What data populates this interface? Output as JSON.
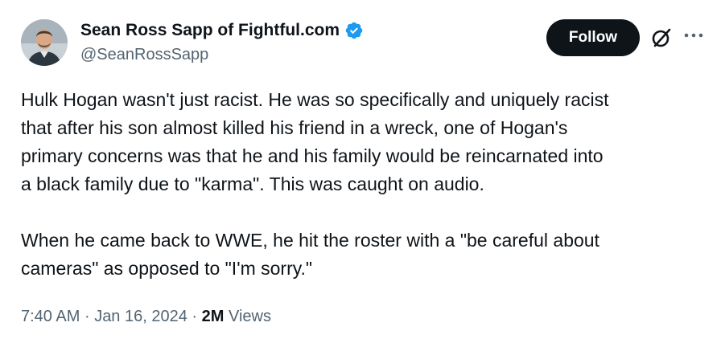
{
  "author": {
    "display_name": "Sean Ross Sapp of Fightful.com",
    "handle": "@SeanRossSapp",
    "verified": true
  },
  "actions": {
    "follow_label": "Follow",
    "grok_icon": "grok-icon",
    "more_icon": "more-options-icon"
  },
  "tweet": {
    "paragraph1_lines": [
      "Hulk Hogan wasn't just racist. He was so specifically and uniquely racist",
      "that after his son almost killed his friend in a wreck, one of Hogan's",
      "primary concerns was that he and his family would be reincarnated into",
      "a black family due to \"karma\". This was caught on audio."
    ],
    "paragraph2_lines": [
      "When he came back to WWE, he hit the roster with a \"be careful about",
      "cameras\" as opposed to \"I'm sorry.\""
    ]
  },
  "meta": {
    "time": "7:40 AM",
    "separator": "·",
    "date": "Jan 16, 2024",
    "views_count": "2M",
    "views_label": "Views"
  },
  "colors": {
    "text": "#0f1419",
    "secondary": "#536471",
    "verified_blue": "#1d9bf0",
    "button_bg": "#0f1419"
  }
}
